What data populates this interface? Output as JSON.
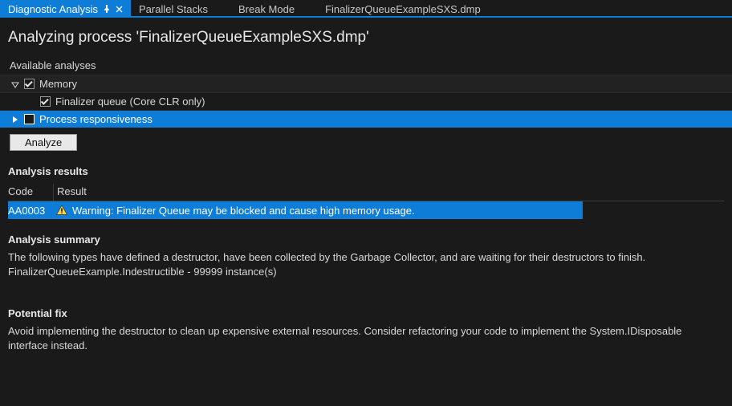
{
  "tabs": [
    {
      "label": "Diagnostic Analysis",
      "active": true
    },
    {
      "label": "Parallel Stacks",
      "active": false
    },
    {
      "label": "Break Mode",
      "active": false
    },
    {
      "label": "FinalizerQueueExampleSXS.dmp",
      "active": false
    }
  ],
  "title": "Analyzing process 'FinalizerQueueExampleSXS.dmp'",
  "analyses": {
    "label": "Available analyses",
    "items": [
      {
        "label": "Memory",
        "checked": true,
        "expanded": true,
        "selected": false,
        "children": true,
        "depth": 0
      },
      {
        "label": "Finalizer queue (Core CLR only)",
        "checked": true,
        "expanded": false,
        "selected": false,
        "children": false,
        "depth": 1
      },
      {
        "label": "Process responsiveness",
        "checked": false,
        "expanded": false,
        "selected": true,
        "children": true,
        "depth": 0
      }
    ]
  },
  "analyze_button": "Analyze",
  "results": {
    "heading": "Analysis results",
    "columns": {
      "code": "Code",
      "result": "Result"
    },
    "rows": [
      {
        "code": "AA0003",
        "result": "Warning: Finalizer Queue may be blocked and cause high memory usage.",
        "severity": "warning"
      }
    ]
  },
  "summary": {
    "heading": "Analysis summary",
    "line1": "The following types have defined a destructor, have been collected by the Garbage Collector, and are waiting for their destructors to finish.",
    "line2": "FinalizerQueueExample.Indestructible - 99999 instance(s)"
  },
  "fix": {
    "heading": "Potential fix",
    "text": "Avoid implementing the destructor to clean up expensive external resources. Consider refactoring your code to implement the System.IDisposable interface instead."
  }
}
